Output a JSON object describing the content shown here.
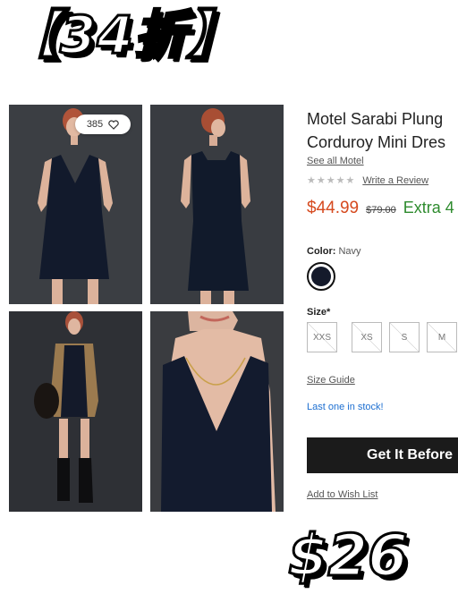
{
  "banner": {
    "top_text": "【34折】",
    "price_text": "$26"
  },
  "gallery": {
    "like_count": "385"
  },
  "product": {
    "title_line1": "Motel Sarabi Plung",
    "title_line2": "Corduroy Mini Dres",
    "brand_link": "See all Motel",
    "stars": "★★★★★",
    "review_link": "Write a Review",
    "sale_price": "$44.99",
    "original_price": "$79.00",
    "extra_text": "Extra 4"
  },
  "color": {
    "label": "Color:",
    "value": "Navy",
    "swatch_hex": "#141a2b"
  },
  "size": {
    "label": "Size*",
    "options": [
      "XXS",
      "XS",
      "S",
      "M"
    ]
  },
  "size_guide": "Size Guide",
  "stock_status": "Last one in stock!",
  "cta_label": "Get It Before",
  "wish_list": "Add to Wish List"
}
